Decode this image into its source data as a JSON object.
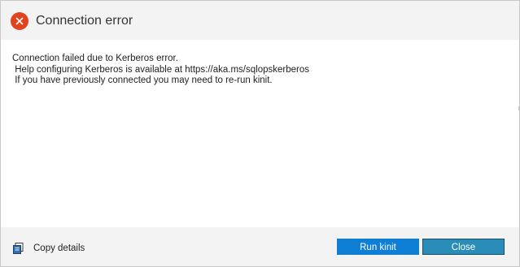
{
  "dialog": {
    "title": "Connection error",
    "message_lines": [
      "Connection failed due to Kerberos error.",
      " Help configuring Kerberos is available at https://aka.ms/sqlopskerberos",
      " If you have previously connected you may need to re-run kinit."
    ]
  },
  "footer": {
    "copy_details_label": "Copy details",
    "primary_button_label": "Run kinit",
    "secondary_button_label": "Close"
  },
  "colors": {
    "error_icon": "#e0431d",
    "primary_button": "#0f7fd6",
    "secondary_button": "#2a8cb8"
  },
  "icons": {
    "header": "error-circle-x-icon",
    "copy": "copy-clipboard-icon"
  }
}
